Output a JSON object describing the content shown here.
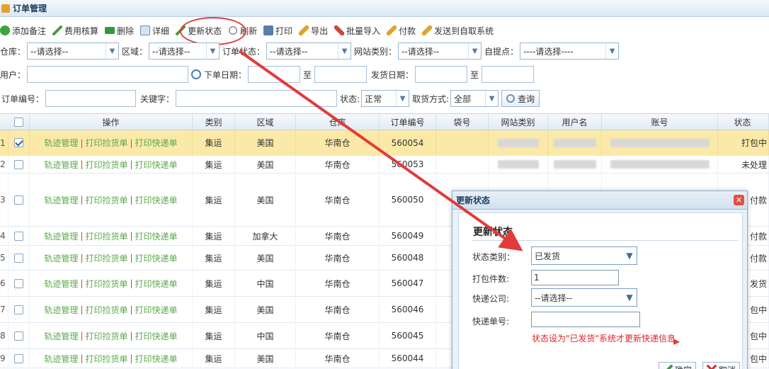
{
  "window": {
    "title": "订单管理"
  },
  "toolbar": {
    "buttons": [
      {
        "label": "添加备注",
        "icon": "plus-icon"
      },
      {
        "label": "费用核算",
        "icon": "pencil-icon"
      },
      {
        "label": "删除",
        "icon": "minus-icon"
      },
      {
        "label": "详细",
        "icon": "document-icon"
      },
      {
        "label": "更新状态",
        "icon": "pencil-icon"
      },
      {
        "label": "刷新",
        "icon": "refresh-icon"
      },
      {
        "label": "打印",
        "icon": "printer-icon"
      },
      {
        "label": "导出",
        "icon": "export-arrow-icon"
      },
      {
        "label": "批量导入",
        "icon": "import-arrow-icon"
      },
      {
        "label": "付款",
        "icon": "pay-arrow-icon"
      },
      {
        "label": "发送到自取系统",
        "icon": "send-arrow-icon"
      }
    ]
  },
  "filters": {
    "warehouse_label": "仓库：",
    "warehouse_value": "--请选择--",
    "region_label": "区域：",
    "region_value": "--请选择--",
    "order_status_label": "订单状态：",
    "order_status_value": "--请选择--",
    "site_type_label": "网站类别：",
    "site_type_value": "--请选择--",
    "pickup_label": "自提点：",
    "pickup_value": "----请选择----",
    "user_label": "用户：",
    "order_date_label": "下单日期：",
    "to_label_1": "至",
    "ship_date_label": "发货日期：",
    "to_label_2": "至",
    "order_no_label": "订单编号：",
    "keyword_label": "关键字：",
    "status_label": "状态:",
    "status_value": "正常",
    "pickup_method_label": "取货方式:",
    "pickup_method_value": "全部",
    "search_label": "查询"
  },
  "grid": {
    "headers": {
      "op": "操作",
      "type": "类别",
      "region": "区域",
      "warehouse": "仓库",
      "order_no": "订单编号",
      "bag": "袋号",
      "site": "网站类别",
      "user": "用户名",
      "account": "账号",
      "status": "状态"
    },
    "op_links": {
      "track": "轨迹管理",
      "pick": "打印捡货单",
      "express": "打印快递单",
      "sep": "|"
    },
    "rows": [
      {
        "num": "1",
        "checked": true,
        "type": "集运",
        "region": "美国",
        "warehouse": "华南仓",
        "order_no": "560054",
        "status": "打包中"
      },
      {
        "num": "2",
        "checked": false,
        "type": "集运",
        "region": "美国",
        "warehouse": "华南仓",
        "order_no": "560053",
        "status": "未处理"
      },
      {
        "num": "3",
        "checked": false,
        "type": "集运",
        "region": "美国",
        "warehouse": "华南仓",
        "order_no": "560050",
        "status": "付款"
      },
      {
        "num": "4",
        "checked": false,
        "type": "集运",
        "region": "加拿大",
        "warehouse": "华南仓",
        "order_no": "560049",
        "status": "付款"
      },
      {
        "num": "5",
        "checked": false,
        "type": "集运",
        "region": "美国",
        "warehouse": "华南仓",
        "order_no": "560048",
        "status": "付款"
      },
      {
        "num": "6",
        "checked": false,
        "type": "集运",
        "region": "中国",
        "warehouse": "华南仓",
        "order_no": "560047",
        "status": "发货"
      },
      {
        "num": "7",
        "checked": false,
        "type": "集运",
        "region": "美国",
        "warehouse": "华南仓",
        "order_no": "560046",
        "status": "包中"
      },
      {
        "num": "8",
        "checked": false,
        "type": "集运",
        "region": "中国",
        "warehouse": "华南仓",
        "order_no": "560045",
        "status": "包中"
      },
      {
        "num": "9",
        "checked": false,
        "type": "集运",
        "region": "美国",
        "warehouse": "华南仓",
        "order_no": "560044",
        "status": "包中"
      }
    ]
  },
  "dialog": {
    "title": "更新状态",
    "heading": "更新状态",
    "status_type_label": "状态类别：",
    "status_type_value": "已发货",
    "pack_count_label": "打包件数:",
    "pack_count_value": "1",
    "courier_label": "快递公司:",
    "courier_value": "--请选择--",
    "tracking_label": "快递单号:",
    "tracking_value": "",
    "hint": "状态设为\"已发货\"系统才更新快递信息",
    "ok_label": "确定",
    "cancel_label": "取消"
  },
  "colors": {
    "annotation": "#e23b3b",
    "hint": "#e0232b",
    "selected_row": "#fbe9a8",
    "link": "#5aa94a"
  }
}
